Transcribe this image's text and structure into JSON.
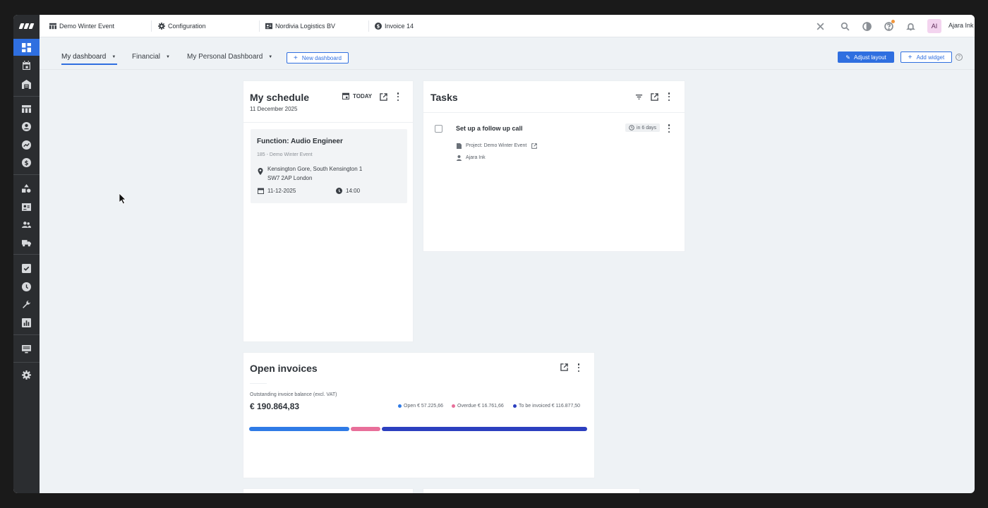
{
  "topbar": {
    "tabs": [
      {
        "label": "Demo Winter Event",
        "icon": "table-icon"
      },
      {
        "label": "Configuration",
        "icon": "gear-icon"
      },
      {
        "label": "Nordivia Logistics BV",
        "icon": "contact-card-icon"
      },
      {
        "label": "Invoice 14",
        "icon": "dollar-icon"
      }
    ],
    "user": {
      "initials": "AI",
      "name": "Ajara Ink"
    }
  },
  "dashboard_tabs": [
    {
      "label": "My dashboard",
      "active": true
    },
    {
      "label": "Financial"
    },
    {
      "label": "My Personal Dashboard"
    }
  ],
  "buttons": {
    "new_dashboard": "New dashboard",
    "adjust_layout": "Adjust layout",
    "add_widget": "Add widget",
    "today": "TODAY"
  },
  "schedule": {
    "title": "My schedule",
    "date": "11 December 2025",
    "item": {
      "title": "Function: Audio Engineer",
      "subtitle": "185 - Demo Winter Event",
      "address_line1": "Kensington Gore, South Kensington 1",
      "address_line2": "SW7 2AP London",
      "date": "11-12-2025",
      "time": "14:00"
    }
  },
  "tasks": {
    "title": "Tasks",
    "item": {
      "title": "Set up a follow up call",
      "due": "in 6 days",
      "project": "Project: Demo Winter Event",
      "assignee": "Ajara Ink"
    }
  },
  "invoices": {
    "title": "Open invoices",
    "label": "Outstanding invoice balance (excl. VAT)",
    "total": "€ 190.864,83",
    "legend": [
      {
        "label": "Open",
        "value": "€ 57.225,66",
        "color": "#2f7be6",
        "amount": 57225.66
      },
      {
        "label": "Overdue",
        "value": "€ 16.761,66",
        "color": "#e86f9a",
        "amount": 16761.66
      },
      {
        "label": "To be invoiced",
        "value": "€ 116.877,50",
        "color": "#2c3fbf",
        "amount": 116877.5
      }
    ]
  },
  "colors": {
    "accent": "#2f6fe0",
    "sidebar": "#2b2d30"
  }
}
